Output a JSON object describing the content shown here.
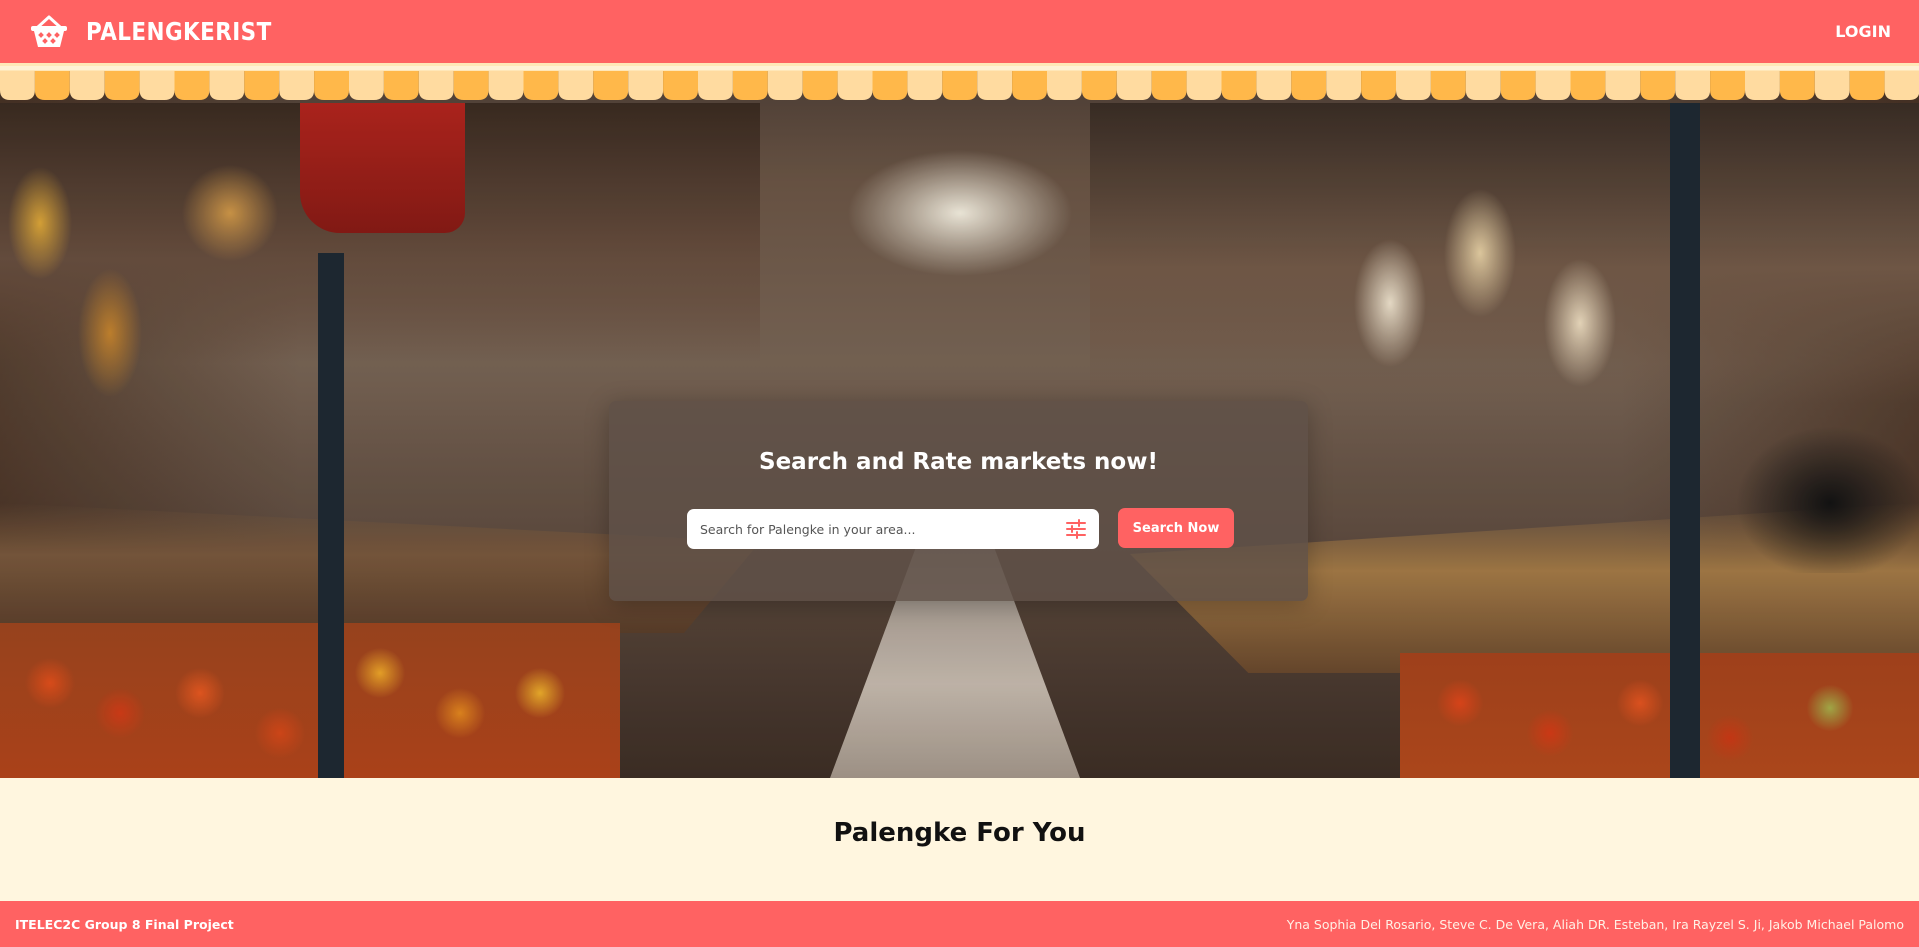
{
  "header": {
    "brand_name": "PALENGKERIST",
    "brand_icon": "market-basket-icon",
    "login_label": "LOGIN"
  },
  "hero": {
    "search_title": "Search and Rate markets now!",
    "search_placeholder": "Search for Palengke in your area...",
    "search_value": "",
    "filter_icon": "sliders-icon",
    "search_button_label": "Search Now"
  },
  "section": {
    "title": "Palengke For You"
  },
  "footer": {
    "left_text": "ITELEC2C Group 8 Final Project",
    "right_text": "Yna Sophia Del Rosario, Steve C. De Vera, Aliah DR. Esteban, Ira Rayzel S. Ji, Jakob Michael Palomo"
  },
  "colors": {
    "primary": "#ff6262",
    "background": "#fff6df",
    "awning_dark": "#ffb84a",
    "awning_light": "#ffdba0"
  }
}
